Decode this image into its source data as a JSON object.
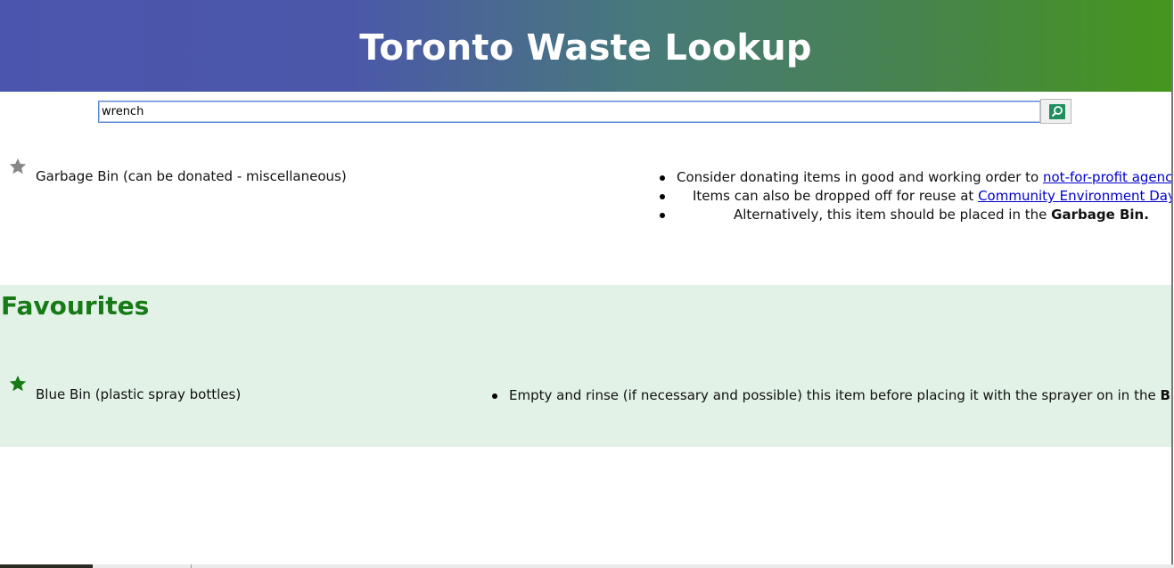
{
  "header": {
    "title": "Toronto Waste Lookup"
  },
  "search": {
    "value": "wrench",
    "button_icon": "search-icon"
  },
  "results": [
    {
      "title": "Garbage Bin (can be donated - miscellaneous)",
      "favourited": false,
      "star_color": "#888888",
      "description": [
        {
          "text_before": "Consider donating items in good and working order to ",
          "link": "not-for-profit agencies",
          "text_after": ".",
          "bold": ""
        },
        {
          "text_before": "Items can also be dropped off for reuse at ",
          "link": "Community Environment Days",
          "text_after": ".",
          "bold": ""
        },
        {
          "text_before": "Alternatively, this item should be placed in the ",
          "link": "",
          "text_after": "",
          "bold": "Garbage Bin."
        }
      ]
    }
  ],
  "favourites": {
    "heading": "Favourites",
    "background": "#e2f2e7",
    "heading_color": "#177a17",
    "items": [
      {
        "title": "Blue Bin (plastic spray bottles)",
        "favourited": true,
        "star_color": "#177a17",
        "description": [
          {
            "text_before": "Empty and rinse (if necessary and possible) this item before placing it with the sprayer on in the ",
            "bold": "Blue Bin."
          }
        ]
      }
    ]
  },
  "colors": {
    "header_gradient_start": "#4b55ad",
    "header_gradient_end": "#45961c",
    "search_button": "#1f8f5f",
    "link": "#0000cc"
  }
}
